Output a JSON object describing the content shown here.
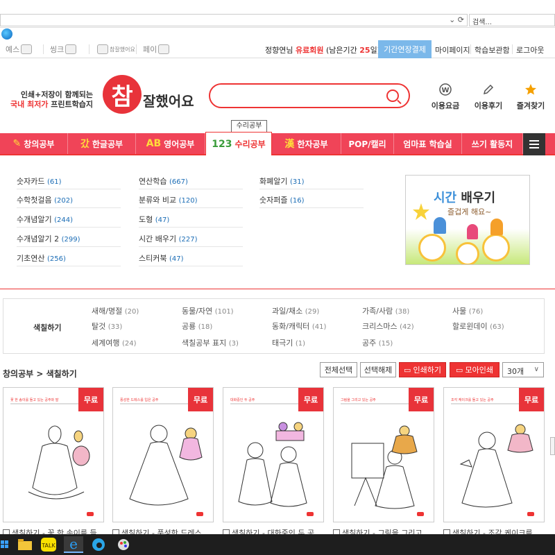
{
  "browser": {
    "search_placeholder": "검색...",
    "address_controls": "⌄ ⟳"
  },
  "utilbar": {
    "services": [
      "예스",
      "씽크",
      "참잘했어요",
      "페이"
    ],
    "user_name": "정향연님",
    "member_type": "유료회원",
    "remaining_prefix": "(남은기간 ",
    "remaining_days": "25",
    "remaining_suffix": "일)",
    "extend_button": "기간연장결제",
    "links": [
      "마이페이지",
      "학습보관함",
      "로그아웃"
    ]
  },
  "header": {
    "slogan_line1": "인쇄+저장이 함께되는",
    "slogan_line2_highlight": "국내 최저가",
    "slogan_line2_rest": " 프린트학습지",
    "logo_big": "참",
    "logo_rest": "잘했어요",
    "links": [
      {
        "label": "이용요금",
        "icon": "won-icon"
      },
      {
        "label": "이용후기",
        "icon": "pencil-icon"
      },
      {
        "label": "즐겨찾기",
        "icon": "star-icon"
      }
    ]
  },
  "tooltip": "수리공부",
  "nav": {
    "items": [
      {
        "label": "창의공부",
        "icon": "✎"
      },
      {
        "label": "한글공부",
        "icon": "갔"
      },
      {
        "label": "영어공부",
        "icon": "AB"
      },
      {
        "label": "수리공부",
        "icon": "123"
      },
      {
        "label": "한자공부",
        "icon": "漢"
      },
      {
        "label": "POP/캘리",
        "icon": ""
      },
      {
        "label": "엄마표 학습실",
        "icon": ""
      },
      {
        "label": "쓰기 활동지",
        "icon": ""
      }
    ]
  },
  "submenu": {
    "col1": [
      {
        "label": "숫자카드",
        "count": "(61)"
      },
      {
        "label": "수학첫걸음",
        "count": "(202)"
      },
      {
        "label": "수개념알기",
        "count": "(244)"
      },
      {
        "label": "수개념알기 2",
        "count": "(299)"
      },
      {
        "label": "기초연산",
        "count": "(256)"
      }
    ],
    "col2": [
      {
        "label": "연산학습",
        "count": "(667)"
      },
      {
        "label": "분류와 비교",
        "count": "(120)"
      },
      {
        "label": "도형",
        "count": "(47)"
      },
      {
        "label": "시간 배우기",
        "count": "(227)"
      },
      {
        "label": "스티커북",
        "count": "(47)"
      }
    ],
    "col3": [
      {
        "label": "화폐알기",
        "count": "(31)"
      },
      {
        "label": "숫자퍼즐",
        "count": "(16)"
      }
    ],
    "promo_title_a": "시간 ",
    "promo_title_b": "배우기",
    "promo_sub": "즐겁게 해요~"
  },
  "categories": {
    "title": "색칠하기",
    "items": [
      {
        "label": "새해/명절",
        "count": "(20)"
      },
      {
        "label": "동물/자연",
        "count": "(101)"
      },
      {
        "label": "과일/채소",
        "count": "(29)"
      },
      {
        "label": "가족/사람",
        "count": "(38)"
      },
      {
        "label": "사물",
        "count": "(76)"
      },
      {
        "label": "탈것",
        "count": "(33)"
      },
      {
        "label": "공룡",
        "count": "(18)"
      },
      {
        "label": "동화/캐릭터",
        "count": "(41)"
      },
      {
        "label": "크리스마스",
        "count": "(42)"
      },
      {
        "label": "할로윈데이",
        "count": "(63)"
      },
      {
        "label": "세계여행",
        "count": "(24)"
      },
      {
        "label": "색칠공부 표지",
        "count": "(3)"
      },
      {
        "label": "태극기",
        "count": "(1)"
      },
      {
        "label": "공주",
        "count": "(15)"
      }
    ]
  },
  "toolbar": {
    "breadcrumb": "창의공부 > 색칠하기",
    "select_all": "전체선택",
    "deselect": "선택해제",
    "print": "인쇄하기",
    "batch_print": "모아인쇄",
    "per_page": "30개"
  },
  "cards": [
    {
      "badge": "무료",
      "sheet_title": "꽃 한 송이를 들고 있는 공주와 말",
      "caption": "색칠하기 - 꽃 한 송이를 들"
    },
    {
      "badge": "무료",
      "sheet_title": "풍성한 드레스를 입은 공주",
      "caption": "색칠하기 - 풍성한 드레스"
    },
    {
      "badge": "무료",
      "sheet_title": "대화중인 두 공주",
      "caption": "색칠하기 - 대화중인 두 공"
    },
    {
      "badge": "무료",
      "sheet_title": "그림을 그리고 있는 공주",
      "caption": "색칠하기 - 그림을 그리고"
    },
    {
      "badge": "무료",
      "sheet_title": "조각 케이크를 들고 있는 공주",
      "caption": "색칠하기 - 조각 케이크를"
    }
  ]
}
